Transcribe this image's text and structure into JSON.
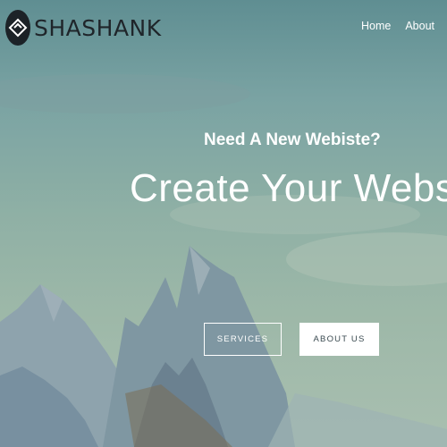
{
  "header": {
    "logo_text": "SHASHANK",
    "nav": [
      {
        "label": "Home"
      },
      {
        "label": "About"
      }
    ]
  },
  "hero": {
    "subtitle": "Need A New Webiste?",
    "title": "Create Your Website",
    "buttons": {
      "services": "SERVICES",
      "about": "ABOUT US"
    }
  },
  "colors": {
    "sky_top": "#5f8e92",
    "sky_bottom": "#a9bfb0",
    "mountains": "#7f98a2",
    "logo_dark": "#1c2227",
    "text_light": "#ffffff"
  },
  "icons": {
    "logo": "diamond-logo-icon"
  }
}
